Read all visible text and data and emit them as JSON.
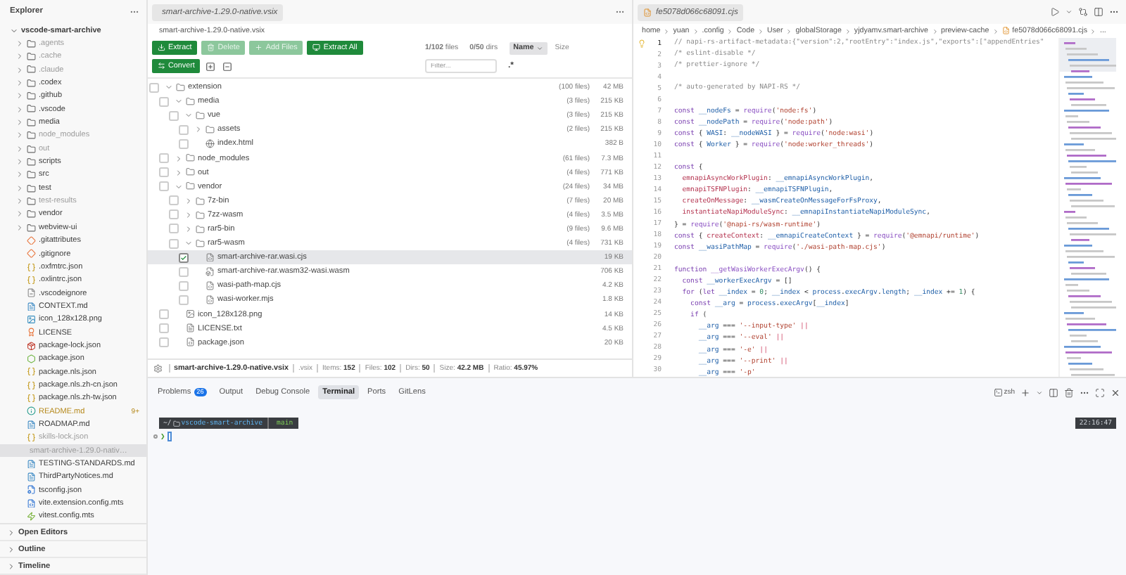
{
  "sidebar": {
    "title": "Explorer",
    "root": "vscode-smart-archive",
    "items": [
      {
        "label": ".agents",
        "kind": "folder",
        "dimmed": true,
        "selected": false,
        "modified": false
      },
      {
        "label": ".cache",
        "kind": "folder",
        "dimmed": true,
        "selected": false,
        "modified": false
      },
      {
        "label": ".claude",
        "kind": "folder",
        "dimmed": true,
        "selected": false,
        "modified": false
      },
      {
        "label": ".codex",
        "kind": "folder",
        "dimmed": false,
        "selected": false,
        "modified": false
      },
      {
        "label": ".github",
        "kind": "folder",
        "dimmed": false,
        "selected": false,
        "modified": false
      },
      {
        "label": ".vscode",
        "kind": "folder",
        "dimmed": false,
        "selected": false,
        "modified": false
      },
      {
        "label": "media",
        "kind": "folder",
        "dimmed": false,
        "selected": false,
        "modified": false
      },
      {
        "label": "node_modules",
        "kind": "folder",
        "dimmed": true,
        "selected": false,
        "modified": false
      },
      {
        "label": "out",
        "kind": "folder",
        "dimmed": true,
        "selected": false,
        "modified": false
      },
      {
        "label": "scripts",
        "kind": "folder",
        "dimmed": false,
        "selected": false,
        "modified": false
      },
      {
        "label": "src",
        "kind": "folder",
        "dimmed": false,
        "selected": false,
        "modified": false
      },
      {
        "label": "test",
        "kind": "folder",
        "dimmed": false,
        "selected": false,
        "modified": false
      },
      {
        "label": "test-results",
        "kind": "folder",
        "dimmed": true,
        "selected": false,
        "modified": false
      },
      {
        "label": "vendor",
        "kind": "folder",
        "dimmed": false,
        "selected": false,
        "modified": false
      },
      {
        "label": "webview-ui",
        "kind": "folder",
        "dimmed": false,
        "selected": false,
        "modified": false
      },
      {
        "label": ".gitattributes",
        "kind": "git",
        "dimmed": false,
        "selected": false,
        "modified": false
      },
      {
        "label": ".gitignore",
        "kind": "git",
        "dimmed": false,
        "selected": false,
        "modified": false
      },
      {
        "label": ".oxfmtrc.json",
        "kind": "json",
        "dimmed": false,
        "selected": false,
        "modified": false
      },
      {
        "label": ".oxlintrc.json",
        "kind": "json",
        "dimmed": false,
        "selected": false,
        "modified": false
      },
      {
        "label": ".vscodeignore",
        "kind": "ignore",
        "dimmed": false,
        "selected": false,
        "modified": false
      },
      {
        "label": "CONTEXT.md",
        "kind": "markdown",
        "dimmed": false,
        "selected": false,
        "modified": false
      },
      {
        "label": "icon_128x128.png",
        "kind": "image",
        "dimmed": false,
        "selected": false,
        "modified": false
      },
      {
        "label": "LICENSE",
        "kind": "license",
        "dimmed": false,
        "selected": false,
        "modified": false
      },
      {
        "label": "package-lock.json",
        "kind": "npm",
        "dimmed": false,
        "selected": false,
        "modified": false
      },
      {
        "label": "package.json",
        "kind": "node",
        "dimmed": false,
        "selected": false,
        "modified": false
      },
      {
        "label": "package.nls.json",
        "kind": "json",
        "dimmed": false,
        "selected": false,
        "modified": false
      },
      {
        "label": "package.nls.zh-cn.json",
        "kind": "json",
        "dimmed": false,
        "selected": false,
        "modified": false
      },
      {
        "label": "package.nls.zh-tw.json",
        "kind": "json",
        "dimmed": false,
        "selected": false,
        "modified": false
      },
      {
        "label": "README.md",
        "kind": "readme",
        "dimmed": false,
        "selected": false,
        "modified": true,
        "badge": "9+"
      },
      {
        "label": "ROADMAP.md",
        "kind": "markdown",
        "dimmed": false,
        "selected": false,
        "modified": false
      },
      {
        "label": "skills-lock.json",
        "kind": "json",
        "dimmed": true,
        "selected": false,
        "modified": false
      },
      {
        "label": "smart-archive-1.29.0-nativ…",
        "kind": "vsix",
        "dimmed": true,
        "selected": true,
        "modified": false
      },
      {
        "label": "TESTING-STANDARDS.md",
        "kind": "markdown",
        "dimmed": false,
        "selected": false,
        "modified": false
      },
      {
        "label": "ThirdPartyNotices.md",
        "kind": "markdown",
        "dimmed": false,
        "selected": false,
        "modified": false
      },
      {
        "label": "tsconfig.json",
        "kind": "tsconfig",
        "dimmed": false,
        "selected": false,
        "modified": false
      },
      {
        "label": "vite.extension.config.mts",
        "kind": "ts",
        "dimmed": false,
        "selected": false,
        "modified": false
      },
      {
        "label": "vitest.config.mts",
        "kind": "vitest",
        "dimmed": false,
        "selected": false,
        "modified": false
      }
    ],
    "sections": [
      {
        "label": "Open Editors",
        "expanded": false
      },
      {
        "label": "Outline",
        "expanded": false
      },
      {
        "label": "Timeline",
        "expanded": false
      }
    ]
  },
  "archive": {
    "tab": "smart-archive-1.29.0-native.vsix",
    "breadcrumb": "smart-archive-1.29.0-native.vsix",
    "buttons": [
      {
        "label": "Extract",
        "kind": "extract",
        "disabled": false
      },
      {
        "label": "Delete",
        "kind": "delete",
        "disabled": true
      },
      {
        "label": "Add Files",
        "kind": "add",
        "disabled": true
      },
      {
        "label": "Extract All",
        "kind": "extract-all",
        "disabled": false
      }
    ],
    "convert": "Convert",
    "files_count": "**1/102** files",
    "dirs_count": "**0/50** dirs",
    "sort": "Name",
    "size_column": "Size",
    "filter_placeholder": "Filter...",
    "regex_toggle": ".*",
    "tree": [
      {
        "name": "extension",
        "kind": "folder",
        "count": "(100 files)",
        "size": "42 MB",
        "expanded": true,
        "checked": false,
        "selected": false,
        "children": [
          {
            "name": "media",
            "kind": "folder",
            "count": "(3 files)",
            "size": "215 KB",
            "expanded": true,
            "checked": false,
            "selected": false,
            "children": [
              {
                "name": "vue",
                "kind": "folder",
                "count": "(3 files)",
                "size": "215 KB",
                "expanded": true,
                "checked": false,
                "selected": false,
                "children": [
                  {
                    "name": "assets",
                    "kind": "folder",
                    "count": "(2 files)",
                    "size": "215 KB",
                    "expanded": false,
                    "checked": false,
                    "selected": false
                  },
                  {
                    "name": "index.html",
                    "kind": "html",
                    "size": "382 B",
                    "checked": false,
                    "selected": false
                  }
                ]
              }
            ]
          },
          {
            "name": "node_modules",
            "kind": "folder",
            "count": "(61 files)",
            "size": "7.3 MB",
            "expanded": false,
            "checked": false,
            "selected": false
          },
          {
            "name": "out",
            "kind": "folder",
            "count": "(4 files)",
            "size": "771 KB",
            "expanded": false,
            "checked": false,
            "selected": false
          },
          {
            "name": "vendor",
            "kind": "folder",
            "count": "(24 files)",
            "size": "34 MB",
            "expanded": true,
            "checked": false,
            "selected": false,
            "children": [
              {
                "name": "7z-bin",
                "kind": "folder",
                "count": "(7 files)",
                "size": "20 MB",
                "expanded": false,
                "checked": false,
                "selected": false
              },
              {
                "name": "7zz-wasm",
                "kind": "folder",
                "count": "(4 files)",
                "size": "3.5 MB",
                "expanded": false,
                "checked": false,
                "selected": false
              },
              {
                "name": "rar5-bin",
                "kind": "folder",
                "count": "(9 files)",
                "size": "9.6 MB",
                "expanded": false,
                "checked": false,
                "selected": false
              },
              {
                "name": "rar5-wasm",
                "kind": "folder",
                "count": "(4 files)",
                "size": "731 KB",
                "expanded": true,
                "checked": false,
                "selected": false,
                "children": [
                  {
                    "name": "smart-archive-rar.wasi.cjs",
                    "kind": "script",
                    "size": "19 KB",
                    "checked": true,
                    "selected": true
                  },
                  {
                    "name": "smart-archive-rar.wasm32-wasi.wasm",
                    "kind": "wasm",
                    "size": "706 KB",
                    "checked": false,
                    "selected": false
                  },
                  {
                    "name": "wasi-path-map.cjs",
                    "kind": "script",
                    "size": "4.2 KB",
                    "checked": false,
                    "selected": false
                  },
                  {
                    "name": "wasi-worker.mjs",
                    "kind": "script",
                    "size": "1.8 KB",
                    "checked": false,
                    "selected": false
                  }
                ]
              }
            ]
          },
          {
            "name": "icon_128x128.png",
            "kind": "image",
            "size": "14 KB",
            "checked": false,
            "selected": false
          },
          {
            "name": "LICENSE.txt",
            "kind": "text",
            "size": "4.5 KB",
            "checked": false,
            "selected": false
          },
          {
            "name": "package.json",
            "kind": "json",
            "size": "20 KB",
            "checked": false,
            "selected": false
          }
        ]
      }
    ],
    "status": [
      {
        "kind": "name",
        "text": "smart-archive-1.29.0-native.vsix"
      },
      {
        "kind": "plain",
        "text": ".vsix"
      },
      {
        "kind": "plain",
        "text": "Items: **152**"
      },
      {
        "kind": "plain",
        "text": "Files: **102**"
      },
      {
        "kind": "plain",
        "text": "Dirs: **50**"
      },
      {
        "kind": "plain",
        "text": "Size: **42.2 MB**"
      },
      {
        "kind": "plain",
        "text": "Ratio: **45.97%**"
      }
    ]
  },
  "editor": {
    "tab": "fe5078d066c68091.cjs",
    "breadcrumbs": [
      {
        "label": "home",
        "kind": "folder"
      },
      {
        "label": "yuan",
        "kind": "folder"
      },
      {
        "label": ".config",
        "kind": "folder"
      },
      {
        "label": "Code",
        "kind": "folder"
      },
      {
        "label": "User",
        "kind": "folder"
      },
      {
        "label": "globalStorage",
        "kind": "folder"
      },
      {
        "label": "yjdyamv.smart-archive",
        "kind": "folder"
      },
      {
        "label": "preview-cache",
        "kind": "folder"
      },
      {
        "label": "fe5078d066c68091.cjs",
        "kind": "file"
      },
      {
        "label": "...",
        "kind": "more"
      }
    ],
    "lines": [
      {
        "number": "1",
        "current": true,
        "tokens": [
          {
            "kind": "comment",
            "text": "// napi-rs-artifact-metadata:{\"version\":2,\"rootEntry\":\"index.js\",\"exports\":[\"appendEntries\""
          }
        ]
      },
      {
        "number": "2",
        "current": false,
        "tokens": [
          {
            "kind": "comment",
            "text": "/* eslint-disable */"
          }
        ]
      },
      {
        "number": "3",
        "current": false,
        "tokens": [
          {
            "kind": "comment",
            "text": "/* prettier-ignore */"
          }
        ]
      },
      {
        "number": "4",
        "current": false
      },
      {
        "number": "5",
        "current": false,
        "tokens": [
          {
            "kind": "comment",
            "text": "/* auto-generated by NAPI-RS */"
          }
        ]
      },
      {
        "number": "6",
        "current": false
      },
      {
        "number": "7",
        "current": false,
        "tokens": [
          {
            "kind": "keyword",
            "text": "const "
          },
          {
            "kind": "var",
            "text": "__nodeFs"
          },
          {
            "kind": "punct",
            "text": " = "
          },
          {
            "kind": "func",
            "text": "require"
          },
          {
            "kind": "punct",
            "text": "("
          },
          {
            "kind": "str",
            "text": "'node:fs'"
          },
          {
            "kind": "punct",
            "text": ")"
          }
        ]
      },
      {
        "number": "8",
        "current": false,
        "tokens": [
          {
            "kind": "keyword",
            "text": "const "
          },
          {
            "kind": "var",
            "text": "__nodePath"
          },
          {
            "kind": "punct",
            "text": " = "
          },
          {
            "kind": "func",
            "text": "require"
          },
          {
            "kind": "punct",
            "text": "("
          },
          {
            "kind": "str",
            "text": "'node:path'"
          },
          {
            "kind": "punct",
            "text": ")"
          }
        ]
      },
      {
        "number": "9",
        "current": false,
        "tokens": [
          {
            "kind": "keyword",
            "text": "const "
          },
          {
            "kind": "punct",
            "text": "{ "
          },
          {
            "kind": "var",
            "text": "WASI"
          },
          {
            "kind": "punct",
            "text": ": "
          },
          {
            "kind": "var",
            "text": "__nodeWASI"
          },
          {
            "kind": "punct",
            "text": " } = "
          },
          {
            "kind": "func",
            "text": "require"
          },
          {
            "kind": "punct",
            "text": "("
          },
          {
            "kind": "str",
            "text": "'node:wasi'"
          },
          {
            "kind": "punct",
            "text": ")"
          }
        ]
      },
      {
        "number": "10",
        "current": false,
        "tokens": [
          {
            "kind": "keyword",
            "text": "const "
          },
          {
            "kind": "punct",
            "text": "{ "
          },
          {
            "kind": "var",
            "text": "Worker"
          },
          {
            "kind": "punct",
            "text": " } = "
          },
          {
            "kind": "func",
            "text": "require"
          },
          {
            "kind": "punct",
            "text": "("
          },
          {
            "kind": "str",
            "text": "'node:worker_threads'"
          },
          {
            "kind": "punct",
            "text": ")"
          }
        ]
      },
      {
        "number": "11",
        "current": false
      },
      {
        "number": "12",
        "current": false,
        "tokens": [
          {
            "kind": "keyword",
            "text": "const "
          },
          {
            "kind": "punct",
            "text": "{"
          }
        ]
      },
      {
        "number": "13",
        "current": false,
        "tokens": [
          {
            "kind": "prop",
            "text": "  emnapiAsyncWorkPlugin"
          },
          {
            "kind": "punct",
            "text": ": "
          },
          {
            "kind": "var",
            "text": "__emnapiAsyncWorkPlugin"
          },
          {
            "kind": "punct",
            "text": ","
          }
        ]
      },
      {
        "number": "14",
        "current": false,
        "tokens": [
          {
            "kind": "prop",
            "text": "  emnapiTSFNPlugin"
          },
          {
            "kind": "punct",
            "text": ": "
          },
          {
            "kind": "var",
            "text": "__emnapiTSFNPlugin"
          },
          {
            "kind": "punct",
            "text": ","
          }
        ]
      },
      {
        "number": "15",
        "current": false,
        "tokens": [
          {
            "kind": "prop",
            "text": "  createOnMessage"
          },
          {
            "kind": "punct",
            "text": ": "
          },
          {
            "kind": "var",
            "text": "__wasmCreateOnMessageForFsProxy"
          },
          {
            "kind": "punct",
            "text": ","
          }
        ]
      },
      {
        "number": "16",
        "current": false,
        "tokens": [
          {
            "kind": "prop",
            "text": "  instantiateNapiModuleSync"
          },
          {
            "kind": "punct",
            "text": ": "
          },
          {
            "kind": "var",
            "text": "__emnapiInstantiateNapiModuleSync"
          },
          {
            "kind": "punct",
            "text": ","
          }
        ]
      },
      {
        "number": "17",
        "current": false,
        "tokens": [
          {
            "kind": "punct",
            "text": "} = "
          },
          {
            "kind": "func",
            "text": "require"
          },
          {
            "kind": "punct",
            "text": "("
          },
          {
            "kind": "str",
            "text": "'@napi-rs/wasm-runtime'"
          },
          {
            "kind": "punct",
            "text": ")"
          }
        ]
      },
      {
        "number": "18",
        "current": false,
        "tokens": [
          {
            "kind": "keyword",
            "text": "const "
          },
          {
            "kind": "punct",
            "text": "{ "
          },
          {
            "kind": "prop",
            "text": "createContext"
          },
          {
            "kind": "punct",
            "text": ": "
          },
          {
            "kind": "var",
            "text": "__emnapiCreateContext"
          },
          {
            "kind": "punct",
            "text": " } = "
          },
          {
            "kind": "func",
            "text": "require"
          },
          {
            "kind": "punct",
            "text": "("
          },
          {
            "kind": "str",
            "text": "'@emnapi/runtime'"
          },
          {
            "kind": "punct",
            "text": ")"
          }
        ]
      },
      {
        "number": "19",
        "current": false,
        "tokens": [
          {
            "kind": "keyword",
            "text": "const "
          },
          {
            "kind": "var",
            "text": "__wasiPathMap"
          },
          {
            "kind": "punct",
            "text": " = "
          },
          {
            "kind": "func",
            "text": "require"
          },
          {
            "kind": "punct",
            "text": "("
          },
          {
            "kind": "str",
            "text": "'./wasi-path-map.cjs'"
          },
          {
            "kind": "punct",
            "text": ")"
          }
        ]
      },
      {
        "number": "20",
        "current": false
      },
      {
        "number": "21",
        "current": false,
        "tokens": [
          {
            "kind": "keyword",
            "text": "function "
          },
          {
            "kind": "func",
            "text": "__getWasiWorkerExecArgv"
          },
          {
            "kind": "punct",
            "text": "() {"
          }
        ]
      },
      {
        "number": "22",
        "current": false,
        "tokens": [
          {
            "kind": "keyword",
            "text": "  const "
          },
          {
            "kind": "var",
            "text": "__workerExecArgv"
          },
          {
            "kind": "punct",
            "text": " = []"
          }
        ]
      },
      {
        "number": "23",
        "current": false,
        "tokens": [
          {
            "kind": "keyword",
            "text": "  for "
          },
          {
            "kind": "punct",
            "text": "("
          },
          {
            "kind": "keyword",
            "text": "let "
          },
          {
            "kind": "var",
            "text": "__index"
          },
          {
            "kind": "punct",
            "text": " = "
          },
          {
            "kind": "num",
            "text": "0"
          },
          {
            "kind": "punct",
            "text": "; "
          },
          {
            "kind": "var",
            "text": "__index"
          },
          {
            "kind": "punct",
            "text": " < "
          },
          {
            "kind": "var",
            "text": "process"
          },
          {
            "kind": "punct",
            "text": "."
          },
          {
            "kind": "var",
            "text": "execArgv"
          },
          {
            "kind": "punct",
            "text": "."
          },
          {
            "kind": "var",
            "text": "length"
          },
          {
            "kind": "punct",
            "text": "; "
          },
          {
            "kind": "var",
            "text": "__index"
          },
          {
            "kind": "punct",
            "text": " += "
          },
          {
            "kind": "num",
            "text": "1"
          },
          {
            "kind": "punct",
            "text": ") {"
          }
        ]
      },
      {
        "number": "24",
        "current": false,
        "tokens": [
          {
            "kind": "keyword",
            "text": "    const "
          },
          {
            "kind": "var",
            "text": "__arg"
          },
          {
            "kind": "punct",
            "text": " = "
          },
          {
            "kind": "var",
            "text": "process"
          },
          {
            "kind": "punct",
            "text": "."
          },
          {
            "kind": "var",
            "text": "execArgv"
          },
          {
            "kind": "punct",
            "text": "["
          },
          {
            "kind": "var",
            "text": "__index"
          },
          {
            "kind": "punct",
            "text": "]"
          }
        ]
      },
      {
        "number": "25",
        "current": false,
        "tokens": [
          {
            "kind": "keyword",
            "text": "    if "
          },
          {
            "kind": "punct",
            "text": "("
          }
        ]
      },
      {
        "number": "26",
        "current": false,
        "tokens": [
          {
            "kind": "var",
            "text": "      __arg"
          },
          {
            "kind": "punct",
            "text": " === "
          },
          {
            "kind": "str",
            "text": "'--input-type'"
          },
          {
            "kind": "op",
            "text": " ||"
          }
        ]
      },
      {
        "number": "27",
        "current": false,
        "tokens": [
          {
            "kind": "var",
            "text": "      __arg"
          },
          {
            "kind": "punct",
            "text": " === "
          },
          {
            "kind": "str",
            "text": "'--eval'"
          },
          {
            "kind": "op",
            "text": " ||"
          }
        ]
      },
      {
        "number": "28",
        "current": false,
        "tokens": [
          {
            "kind": "var",
            "text": "      __arg"
          },
          {
            "kind": "punct",
            "text": " === "
          },
          {
            "kind": "str",
            "text": "'-e'"
          },
          {
            "kind": "op",
            "text": " ||"
          }
        ]
      },
      {
        "number": "29",
        "current": false,
        "tokens": [
          {
            "kind": "var",
            "text": "      __arg"
          },
          {
            "kind": "punct",
            "text": " === "
          },
          {
            "kind": "str",
            "text": "'--print'"
          },
          {
            "kind": "op",
            "text": " ||"
          }
        ]
      },
      {
        "number": "30",
        "current": false,
        "tokens": [
          {
            "kind": "var",
            "text": "      __arg"
          },
          {
            "kind": "punct",
            "text": " === "
          },
          {
            "kind": "str",
            "text": "'-p'"
          }
        ]
      }
    ]
  },
  "panel": {
    "tabs": [
      {
        "label": "Problems",
        "badge": "26",
        "selected": false
      },
      {
        "label": "Output",
        "selected": false
      },
      {
        "label": "Debug Console",
        "selected": false
      },
      {
        "label": "Terminal",
        "selected": true
      },
      {
        "label": "Ports",
        "selected": false
      },
      {
        "label": "GitLens",
        "selected": false
      }
    ],
    "shell": "zsh",
    "terminal": {
      "path_prefix": "~/",
      "directory": "vscode-smart-archive",
      "branch": "main",
      "time": "22:16:47",
      "prompt": "❯"
    }
  }
}
